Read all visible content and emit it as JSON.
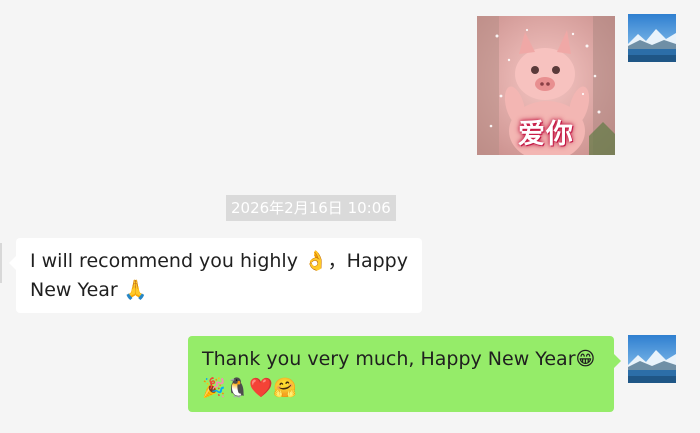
{
  "sticker": {
    "caption": "爱你"
  },
  "timestamp": "2026年2月16日 10:06",
  "messages": {
    "incoming": {
      "line1": "I will recommend you highly 👌，Happy",
      "line2": "New Year 🙏"
    },
    "outgoing": {
      "line1": "Thank you very much, Happy New Year😁",
      "line2": "🎉🐧❤️🤗"
    }
  },
  "colors": {
    "background": "#f5f5f5",
    "incoming_bubble": "#ffffff",
    "outgoing_bubble": "#95ec69",
    "timestamp_bg": "#dadada"
  },
  "icons": [
    "mountain-lake-avatar",
    "pig-sticker",
    "ok-hand-emoji",
    "folded-hands-emoji",
    "grinning-emoji",
    "party-popper-emoji",
    "penguin-emoji",
    "heart-emoji",
    "hugging-emoji"
  ]
}
